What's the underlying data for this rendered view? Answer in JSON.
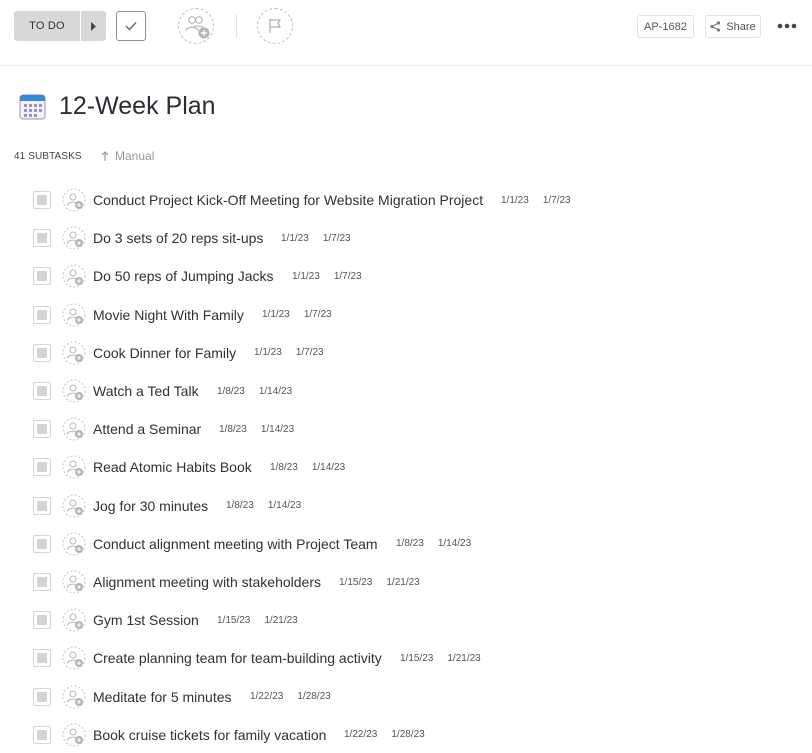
{
  "toolbar": {
    "status_label": "TO DO",
    "task_id": "AP-1682",
    "share_label": "Share",
    "colors": {
      "status_bg": "#d8d8d8",
      "border": "#e2e2e2",
      "dashed": "#bdbdbd"
    }
  },
  "task": {
    "title": "12-Week Plan",
    "title_icon": "calendar-icon"
  },
  "subtasks": {
    "count_label": "41 SUBTASKS",
    "sort_label": "Manual",
    "items": [
      {
        "name": "Conduct Project Kick-Off Meeting for Website Migration Project",
        "start": "1/1/23",
        "due": "1/7/23"
      },
      {
        "name": "Do 3 sets of 20 reps sit-ups",
        "start": "1/1/23",
        "due": "1/7/23"
      },
      {
        "name": "Do 50 reps of Jumping Jacks",
        "start": "1/1/23",
        "due": "1/7/23"
      },
      {
        "name": "Movie Night With Family",
        "start": "1/1/23",
        "due": "1/7/23"
      },
      {
        "name": "Cook Dinner for Family",
        "start": "1/1/23",
        "due": "1/7/23"
      },
      {
        "name": "Watch a Ted Talk",
        "start": "1/8/23",
        "due": "1/14/23"
      },
      {
        "name": "Attend a Seminar",
        "start": "1/8/23",
        "due": "1/14/23"
      },
      {
        "name": "Read Atomic Habits Book",
        "start": "1/8/23",
        "due": "1/14/23"
      },
      {
        "name": "Jog for 30 minutes",
        "start": "1/8/23",
        "due": "1/14/23"
      },
      {
        "name": "Conduct alignment meeting with Project Team",
        "start": "1/8/23",
        "due": "1/14/23"
      },
      {
        "name": "Alignment meeting with stakeholders",
        "start": "1/15/23",
        "due": "1/21/23"
      },
      {
        "name": "Gym 1st Session",
        "start": "1/15/23",
        "due": "1/21/23"
      },
      {
        "name": "Create planning team for team-building activity",
        "start": "1/15/23",
        "due": "1/21/23"
      },
      {
        "name": "Meditate for 5 minutes",
        "start": "1/22/23",
        "due": "1/28/23"
      },
      {
        "name": "Book cruise tickets for family vacation",
        "start": "1/22/23",
        "due": "1/28/23"
      }
    ]
  }
}
